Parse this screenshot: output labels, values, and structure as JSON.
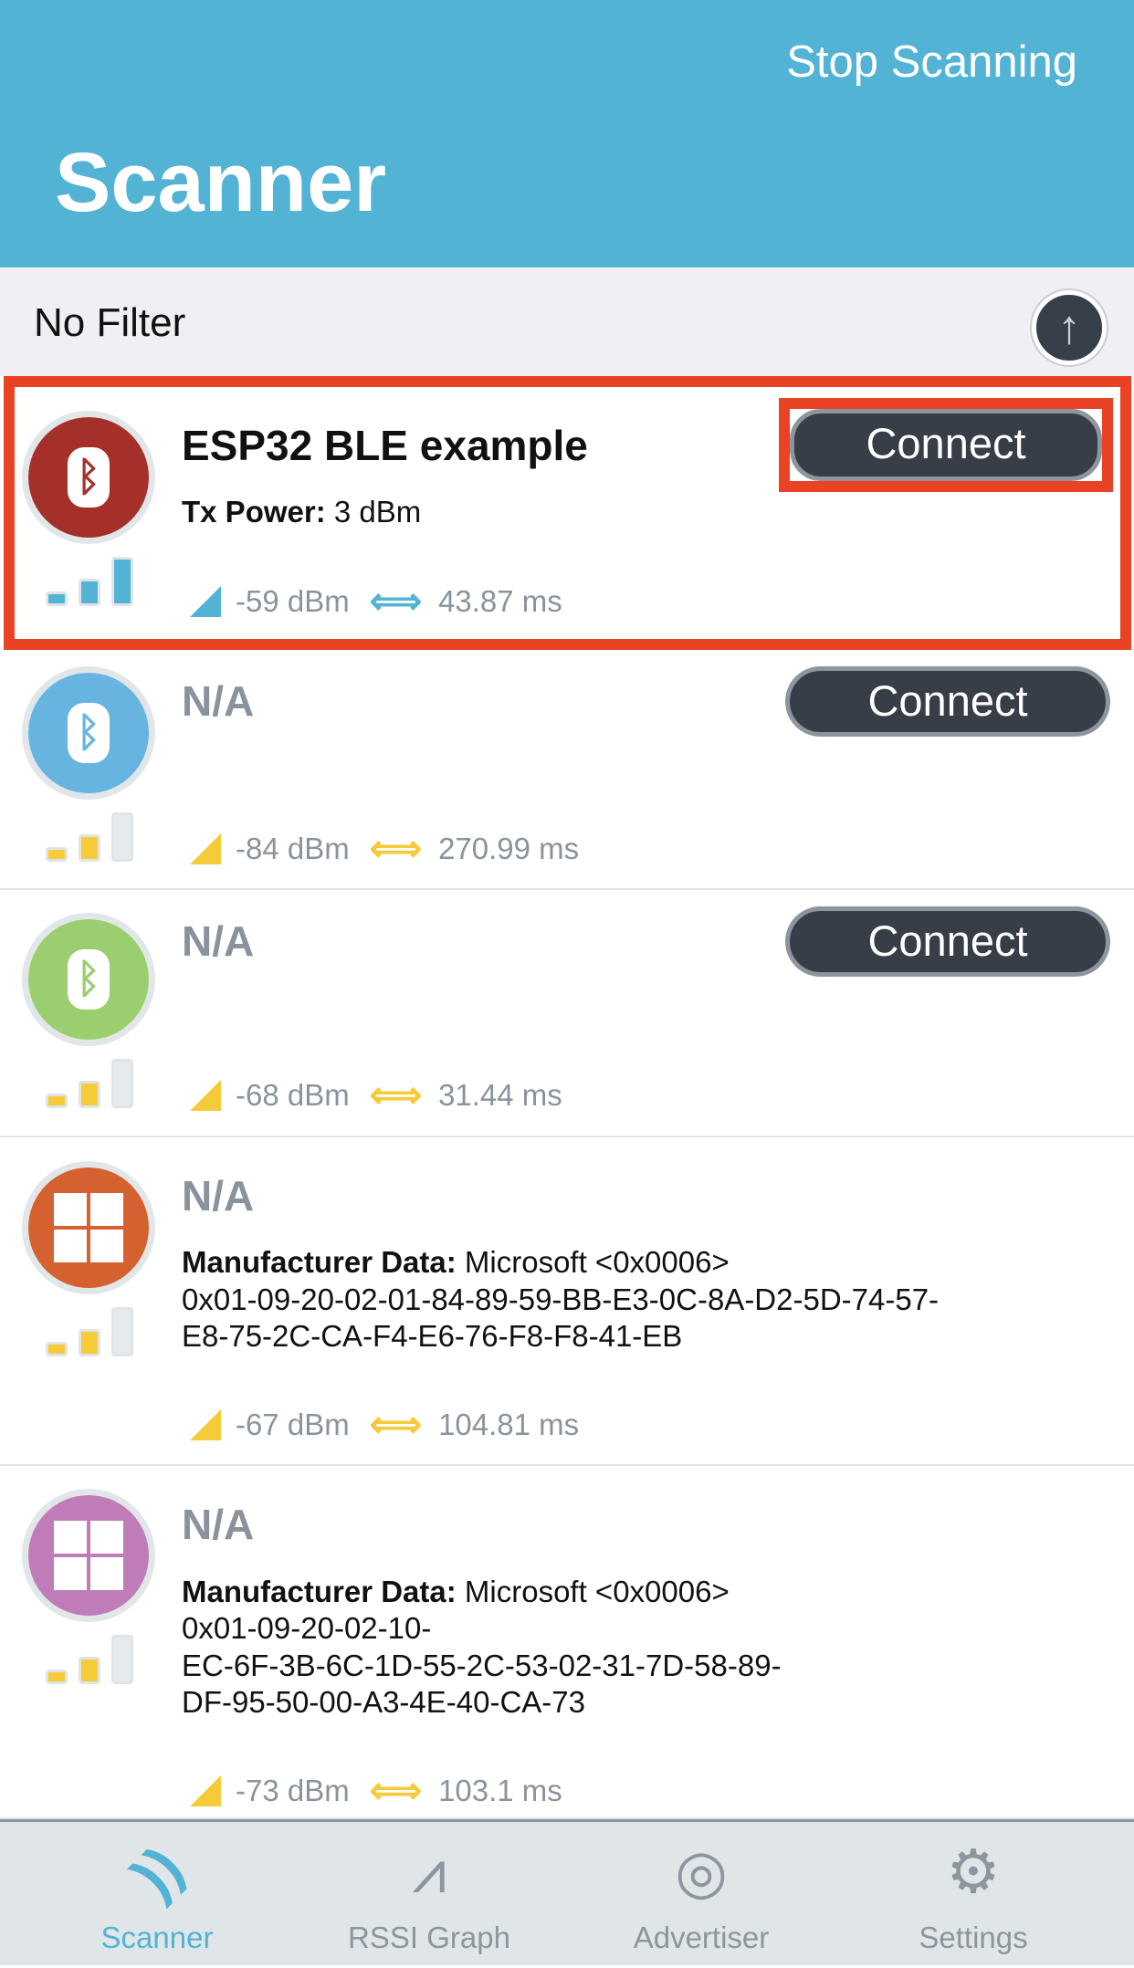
{
  "header": {
    "title": "Scanner",
    "stop_label": "Stop Scanning"
  },
  "filter": {
    "label": "No Filter",
    "up_icon": "arrow-up-icon"
  },
  "connect_label": "Connect",
  "devices": [
    {
      "name": "ESP32 BLE example",
      "icon": "bluetooth-icon",
      "color": "#a5302a",
      "tx_label": "Tx Power:",
      "tx_value": "3 dBm",
      "rssi": "-59 dBm",
      "interval": "43.87 ms",
      "signal_level": 3,
      "signal_color": "#52b3d5",
      "connectable": true,
      "highlighted": true
    },
    {
      "name": "N/A",
      "icon": "bluetooth-icon",
      "color": "#67b4e0",
      "rssi": "-84 dBm",
      "interval": "270.99 ms",
      "signal_level": 2,
      "signal_color": "#f5cb3a",
      "connectable": true
    },
    {
      "name": "N/A",
      "icon": "bluetooth-icon",
      "color": "#9bce6e",
      "rssi": "-68 dBm",
      "interval": "31.44 ms",
      "signal_level": 2,
      "signal_color": "#f5cb3a",
      "connectable": true
    },
    {
      "name": "N/A",
      "icon": "windows-icon",
      "color": "#d4612f",
      "mfr_label": "Manufacturer Data:",
      "mfr_value": "Microsoft <0x0006>",
      "mfr_lines": [
        "0x01-09-20-02-01-84-89-59-BB-E3-0C-8A-D2-5D-74-57-",
        "E8-75-2C-CA-F4-E6-76-F8-F8-41-EB"
      ],
      "rssi": "-67 dBm",
      "interval": "104.81 ms",
      "signal_level": 2,
      "signal_color": "#f5cb3a",
      "connectable": false
    },
    {
      "name": "N/A",
      "icon": "windows-icon",
      "color": "#c07cb8",
      "mfr_label": "Manufacturer Data:",
      "mfr_value": "Microsoft <0x0006>",
      "mfr_lines": [
        "0x01-09-20-02-10-",
        "EC-6F-3B-6C-1D-55-2C-53-02-31-7D-58-89-",
        "DF-95-50-00-A3-4E-40-CA-73"
      ],
      "rssi": "-73 dBm",
      "interval": "103.1 ms",
      "signal_level": 2,
      "signal_color": "#f5cb3a",
      "connectable": false
    }
  ],
  "tabs": [
    {
      "label": "Scanner",
      "icon": "scanner-icon",
      "active": true
    },
    {
      "label": "RSSI Graph",
      "icon": "graph-icon",
      "active": false
    },
    {
      "label": "Advertiser",
      "icon": "broadcast-icon",
      "active": false
    },
    {
      "label": "Settings",
      "icon": "gears-icon",
      "active": false
    }
  ]
}
